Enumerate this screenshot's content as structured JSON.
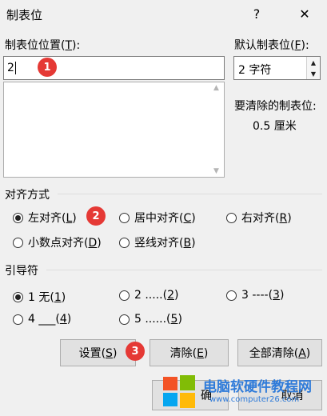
{
  "window": {
    "title": "制表位",
    "help_glyph": "?",
    "close_glyph": "✕"
  },
  "tab_position": {
    "label": "制表位位置(",
    "label_key": "T",
    "label_end": "):",
    "value": "2"
  },
  "default_tab": {
    "label": "默认制表位(",
    "label_key": "F",
    "label_end": "):",
    "value": "2 字符"
  },
  "to_clear": {
    "label": "要清除的制表位:",
    "value": "0.5 厘米"
  },
  "alignment": {
    "title": "对齐方式",
    "options": [
      {
        "text": "左对齐(",
        "key": "L",
        "end": ")",
        "selected": true
      },
      {
        "text": "居中对齐(",
        "key": "C",
        "end": ")",
        "selected": false
      },
      {
        "text": "右对齐(",
        "key": "R",
        "end": ")",
        "selected": false
      },
      {
        "text": "小数点对齐(",
        "key": "D",
        "end": ")",
        "selected": false
      },
      {
        "text": "竖线对齐(",
        "key": "B",
        "end": ")",
        "selected": false
      }
    ]
  },
  "leader": {
    "title": "引导符",
    "options": [
      {
        "text": "1 无(",
        "key": "1",
        "end": ")",
        "selected": true
      },
      {
        "text": "2 .....(",
        "key": "2",
        "end": ")",
        "selected": false
      },
      {
        "text": "3 ----(",
        "key": "3",
        "end": ")",
        "selected": false
      },
      {
        "text": "4 ___(",
        "key": "4",
        "end": ")",
        "selected": false
      },
      {
        "text": "5 ......(",
        "key": "5",
        "end": ")",
        "selected": false
      }
    ]
  },
  "buttons": {
    "set_label": "设置(",
    "set_key": "S",
    "set_end": ")",
    "clear_label": "清除(",
    "clear_key": "E",
    "clear_end": ")",
    "clear_all_label": "全部清除(",
    "clear_all_key": "A",
    "clear_all_end": ")",
    "ok_label": "确",
    "cancel_label": "取消"
  },
  "badges": [
    "1",
    "2",
    "3"
  ],
  "watermark": {
    "title": "电脑软硬件教程网",
    "url": "www.computer26.com"
  },
  "colors": {
    "badge": "#e53935",
    "watermark_title": "#2f7bd9"
  }
}
